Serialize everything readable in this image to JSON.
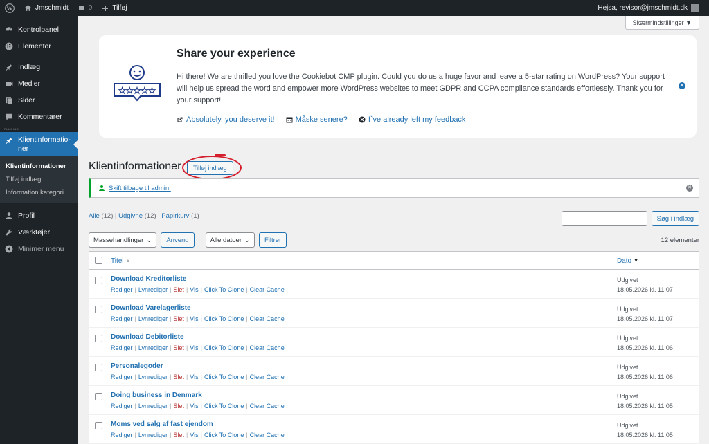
{
  "adminbar": {
    "site_name": "Jmschmidt",
    "comments_count": "0",
    "new_label": "Tilføj",
    "greeting": "Hejsa, revisor@jmschmidt.dk"
  },
  "sidebar": {
    "plugin_separator": "PLUGINS",
    "items": [
      {
        "label": "Kontrolpanel",
        "icon": "dashboard-icon"
      },
      {
        "label": "Elementor",
        "icon": "elementor-icon"
      },
      {
        "label": "Indlæg",
        "icon": "pin-icon"
      },
      {
        "label": "Medier",
        "icon": "media-icon"
      },
      {
        "label": "Sider",
        "icon": "page-icon"
      },
      {
        "label": "Kommentarer",
        "icon": "comment-icon"
      },
      {
        "label": "Klientinformationer",
        "icon": "pin-icon"
      },
      {
        "label": "Profil",
        "icon": "user-icon"
      },
      {
        "label": "Værktøjer",
        "icon": "wrench-icon"
      },
      {
        "label": "Minimer menu",
        "icon": "collapse-icon"
      }
    ],
    "current_label_line1": "Klientinformatio-",
    "current_label_line2": "ner",
    "submenu": [
      "Klientinformationer",
      "Tilføj indlæg",
      "Information kategori"
    ]
  },
  "screen_options": "Skærmindstillinger ▼",
  "notice": {
    "title": "Share your experience",
    "message": "Hi there! We are thrilled you love the Cookiebot CMP plugin. Could you do us a huge favor and leave a 5-star rating on WordPress? Your support will help us spread the word and empower more WordPress websites to meet GDPR and CCPA compliance standards effortlessly. Thank you for your support!",
    "link1": "Absolutely, you deserve it!",
    "link2": "Måske senere?",
    "link3": "I`ve already left my feedback"
  },
  "page": {
    "title": "Klientinformationer",
    "add_new": "Tilføj indlæg"
  },
  "switch_notice": "Skift tilbage til admin.",
  "filters": {
    "all": "Alle",
    "all_count": "(12)",
    "published": "Udgivne",
    "published_count": "(12)",
    "trash": "Papirkurv",
    "trash_count": "(1)",
    "sep": "|"
  },
  "search": {
    "button": "Søg i indlæg"
  },
  "tablenav": {
    "bulk": "Massehandlinger",
    "apply": "Anvend",
    "dates": "Alle datoer",
    "filter": "Filtrer",
    "count": "12 elementer"
  },
  "table": {
    "col_title": "Titel",
    "col_date": "Dato",
    "row_actions": {
      "edit": "Rediger",
      "quick": "Lynrediger",
      "delete": "Slet",
      "view": "Vis",
      "clone": "Click To Clone",
      "cache": "Clear Cache",
      "sep": "|"
    },
    "rows": [
      {
        "title": "Download Kreditorliste",
        "status": "Udgivet",
        "date": "18.05.2026 kl. 11:07"
      },
      {
        "title": "Download Varelagerliste",
        "status": "Udgivet",
        "date": "18.05.2026 kl. 11:07"
      },
      {
        "title": "Download Debitorliste",
        "status": "Udgivet",
        "date": "18.05.2026 kl. 11:06"
      },
      {
        "title": "Personalegoder",
        "status": "Udgivet",
        "date": "18.05.2026 kl. 11:06"
      },
      {
        "title": "Doing business in Denmark",
        "status": "Udgivet",
        "date": "18.05.2026 kl. 11:05"
      },
      {
        "title": "Moms ved salg af fast ejendom",
        "status": "Udgivet",
        "date": "18.05.2026 kl. 11:05"
      }
    ]
  },
  "colors": {
    "adminbar_bg": "#1d2327",
    "accent": "#2271b1",
    "success": "#00a32a",
    "annotation": "#d61f2d"
  }
}
